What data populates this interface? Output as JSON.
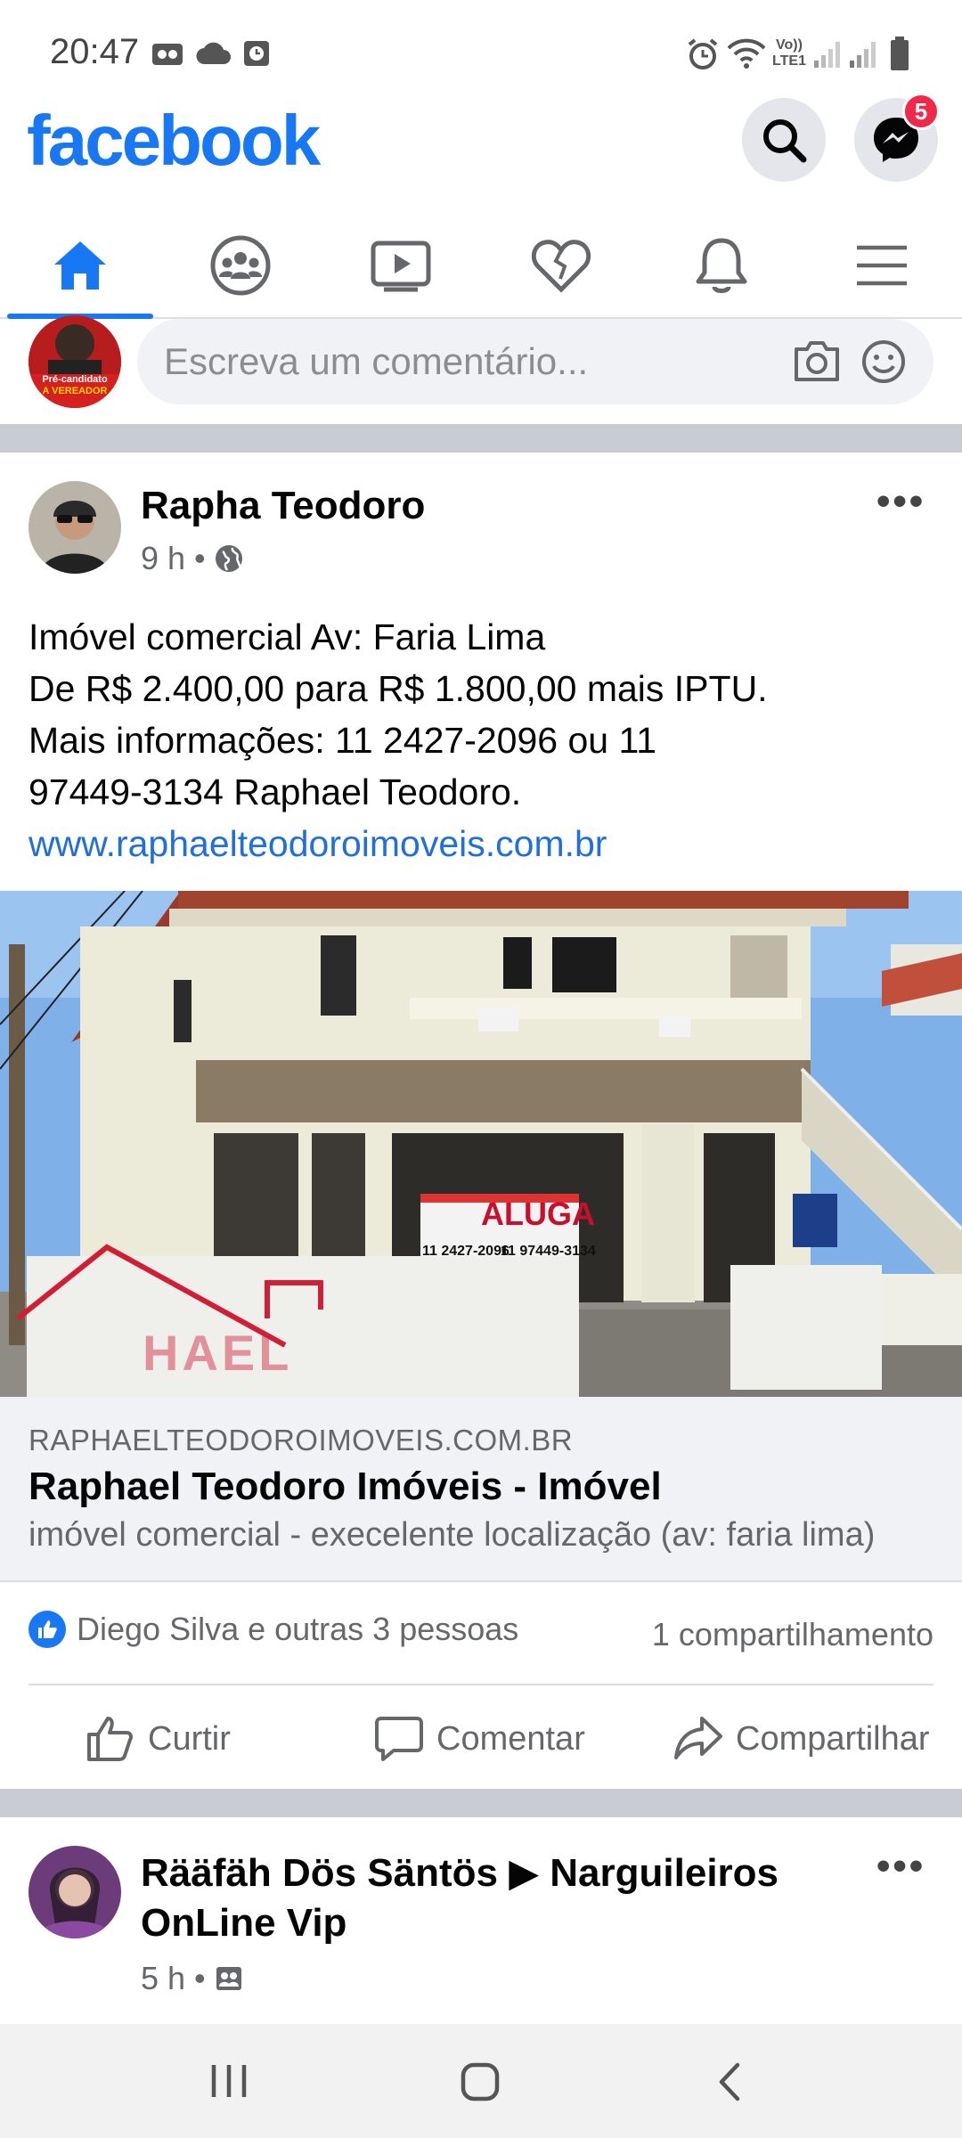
{
  "status_bar": {
    "time": "20:47",
    "volte_label_top": "Vo))",
    "volte_label_bottom": "LTE1"
  },
  "header": {
    "logo": "facebook",
    "messenger_badge": "5",
    "brand_color": "#1877f2"
  },
  "tabs": [
    {
      "name": "home",
      "icon": "home-icon",
      "active": true
    },
    {
      "name": "groups",
      "icon": "groups-icon",
      "active": false
    },
    {
      "name": "watch",
      "icon": "video-icon",
      "active": false
    },
    {
      "name": "dating",
      "icon": "heart-icon",
      "active": false
    },
    {
      "name": "notifications",
      "icon": "bell-icon",
      "active": false
    },
    {
      "name": "menu",
      "icon": "hamburger-icon",
      "active": false
    }
  ],
  "composer": {
    "placeholder": "Escreva um comentário...",
    "avatar_caption_1": "Pré-candidato",
    "avatar_caption_2": "A VEREADOR"
  },
  "post1": {
    "author": "Rapha Teodoro",
    "time": "9 h",
    "privacy_icon": "globe-icon",
    "text_lines": [
      "Imóvel comercial Av: Faria Lima",
      "De R$ 2.400,00 para R$ 1.800,00 mais IPTU.",
      "Mais informações: 11 2427-2096 ou 11",
      "97449-3134 Raphael Teodoro."
    ],
    "link": "www.raphaelteodoroimoveis.com.br",
    "image_sign": {
      "word": "ALUGA",
      "phone1": "11 2427-2096",
      "phone2": "11 97449-3134",
      "watermark": "HAEL"
    },
    "link_card": {
      "domain": "RAPHAELTEODOROIMOVEIS.COM.BR",
      "title": "Raphael Teodoro Imóveis - Imóvel",
      "description": "imóvel comercial - execelente localização (av: faria lima)"
    },
    "reactions_text": "Diego Silva e outras 3 pessoas",
    "shares_text": "1 compartilhamento",
    "actions": {
      "like": "Curtir",
      "comment": "Comentar",
      "share": "Compartilhar"
    }
  },
  "post2": {
    "author_line1": "Rääfäh Dös Säntös ▶ Narguileiros",
    "author_line2": "OnLine Vip",
    "time": "5 h",
    "privacy_icon": "group-icon"
  }
}
